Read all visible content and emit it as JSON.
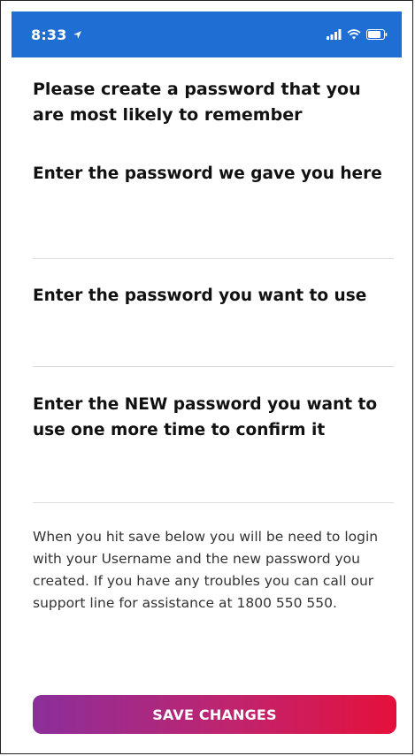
{
  "status_bar": {
    "time": "8:33",
    "location_icon": "location-arrow-icon",
    "signal_icon": "cellular-signal-icon",
    "wifi_icon": "wifi-icon",
    "battery_icon": "battery-icon",
    "background_color": "#1f6ed4"
  },
  "form": {
    "intro": "Please create a password that you are most likely to remember",
    "current_password": {
      "label": "Enter the password we gave you here",
      "value": ""
    },
    "new_password": {
      "label": "Enter the password you want to use",
      "value": ""
    },
    "confirm_password": {
      "label": "Enter the NEW password you want to use one more time to confirm it",
      "value": ""
    }
  },
  "info_text": "When you hit save below you will be need to login with your Username and the new password you created. If you have any troubles you can call our support line for assistance at 1800 550 550.",
  "save_button": {
    "label": "SAVE CHANGES",
    "gradient_start": "#8b2e9b",
    "gradient_end": "#e5103a"
  }
}
